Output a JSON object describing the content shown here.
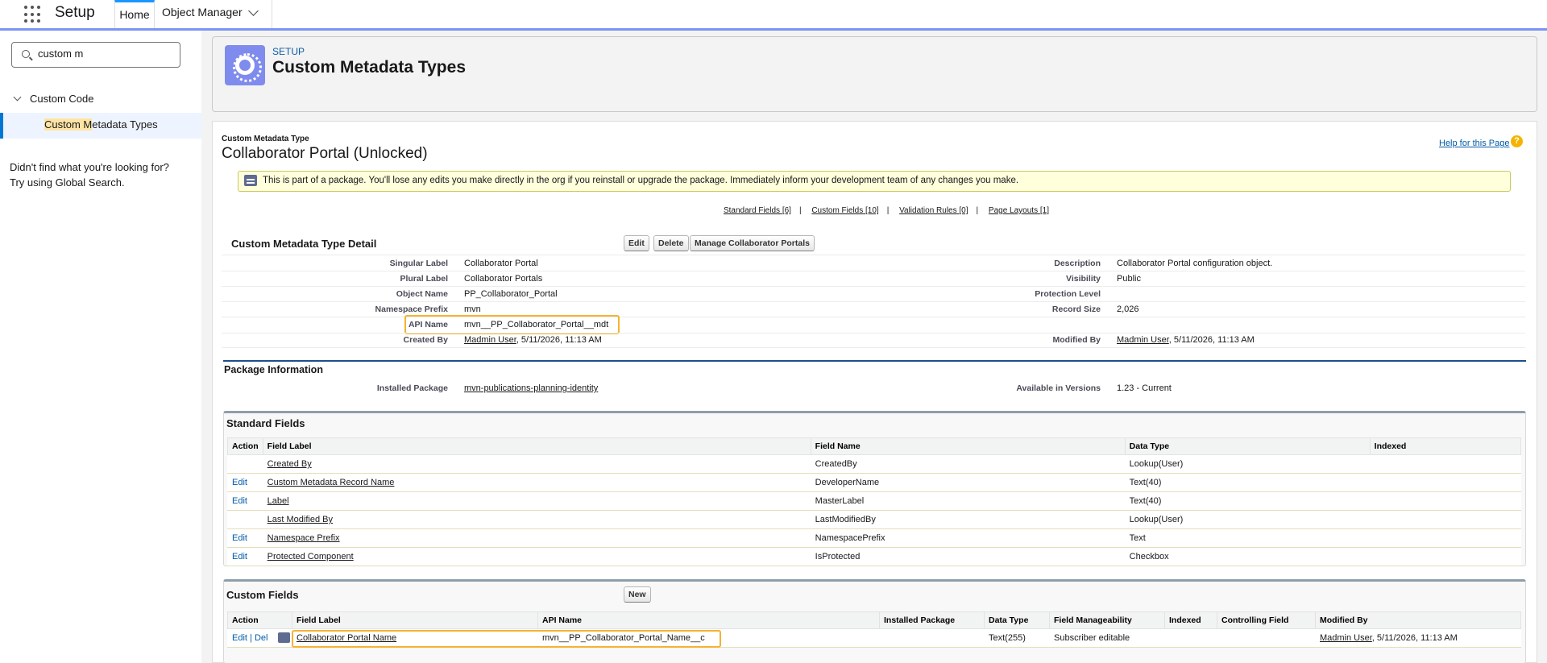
{
  "header": {
    "app_title": "Setup",
    "tabs": [
      {
        "label": "Home"
      },
      {
        "label": "Object Manager"
      }
    ]
  },
  "sidebar": {
    "search_value": "custom m",
    "tree_node": "Custom Code",
    "tree_leaf_highlight": "Custom M",
    "tree_leaf_rest": "etadata Types",
    "not_found_line1": "Didn't find what you're looking for?",
    "not_found_line2": "Try using Global Search."
  },
  "page_header": {
    "eyebrow": "SETUP",
    "title": "Custom Metadata Types"
  },
  "object": {
    "type_label": "Custom Metadata Type",
    "title": "Collaborator Portal (Unlocked)",
    "help_link": "Help for this Page",
    "help_icon": "?",
    "warning": "This is part of a package. You'll lose any edits you make directly in the org if you reinstall or upgrade the package. Immediately inform your development team of any changes you make."
  },
  "quicklinks": [
    {
      "label": "Standard Fields",
      "count": "[6]"
    },
    {
      "label": "Custom Fields",
      "count": "[10]"
    },
    {
      "label": "Validation Rules",
      "count": "[0]"
    },
    {
      "label": "Page Layouts",
      "count": "[1]"
    }
  ],
  "detail": {
    "title": "Custom Metadata Type Detail",
    "buttons": [
      "Edit",
      "Delete",
      "Manage Collaborator Portals"
    ],
    "left": [
      {
        "label": "Singular Label",
        "value": "Collaborator Portal"
      },
      {
        "label": "Plural Label",
        "value": "Collaborator Portals"
      },
      {
        "label": "Object Name",
        "value": "PP_Collaborator_Portal"
      },
      {
        "label": "Namespace Prefix",
        "value": "mvn"
      },
      {
        "label": "API Name",
        "value": "mvn__PP_Collaborator_Portal__mdt"
      },
      {
        "label": "Created By",
        "link": "Madmin User",
        "value": ", 5/11/2026, 11:13 AM"
      }
    ],
    "right": [
      {
        "label": "Description",
        "value": "Collaborator Portal configuration object."
      },
      {
        "label": "Visibility",
        "value": "Public"
      },
      {
        "label": "Protection Level",
        "value": ""
      },
      {
        "label": "Record Size",
        "value": "2,026"
      },
      {
        "label": "Modified By",
        "link": "Madmin User",
        "value": ", 5/11/2026, 11:13 AM"
      }
    ]
  },
  "package_info": {
    "title": "Package Information",
    "installed_label": "Installed Package",
    "installed_value": "mvn-publications-planning-identity",
    "versions_label": "Available in Versions",
    "versions_value": "1.23 - Current"
  },
  "standard_fields": {
    "title": "Standard Fields",
    "columns": [
      "Action",
      "Field Label",
      "Field Name",
      "Data Type",
      "Indexed"
    ],
    "rows": [
      {
        "action": "",
        "label": "Created By",
        "name": "CreatedBy",
        "type": "Lookup(User)",
        "indexed": ""
      },
      {
        "action": "Edit",
        "label": "Custom Metadata Record Name",
        "name": "DeveloperName",
        "type": "Text(40)",
        "indexed": ""
      },
      {
        "action": "Edit",
        "label": "Label",
        "name": "MasterLabel",
        "type": "Text(40)",
        "indexed": ""
      },
      {
        "action": "",
        "label": "Last Modified By",
        "name": "LastModifiedBy",
        "type": "Lookup(User)",
        "indexed": ""
      },
      {
        "action": "Edit",
        "label": "Namespace Prefix",
        "name": "NamespacePrefix",
        "type": "Text",
        "indexed": ""
      },
      {
        "action": "Edit",
        "label": "Protected Component",
        "name": "IsProtected",
        "type": "Checkbox",
        "indexed": ""
      }
    ]
  },
  "custom_fields": {
    "title": "Custom Fields",
    "new_button": "New",
    "columns": [
      "Action",
      "Field Label",
      "API Name",
      "Installed Package",
      "Data Type",
      "Field Manageability",
      "Indexed",
      "Controlling Field",
      "Modified By"
    ],
    "rows": [
      {
        "edit": "Edit",
        "sep": " | ",
        "del": "Del",
        "label": "Collaborator Portal Name",
        "api": "mvn__PP_Collaborator_Portal_Name__c",
        "package": "",
        "type": "Text(255)",
        "manage": "Subscriber editable",
        "indexed": "",
        "controlling": "",
        "modified_link": "Madmin User",
        "modified_rest": ", 5/11/2026, 11:13 AM"
      }
    ]
  }
}
